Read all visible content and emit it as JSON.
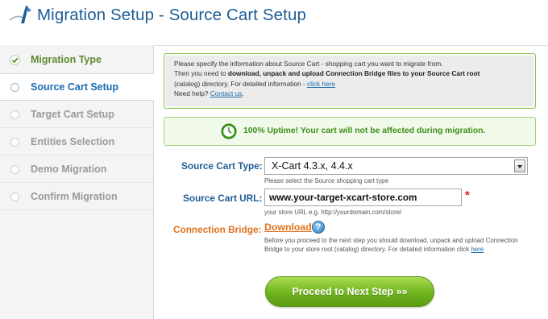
{
  "header": {
    "title": "Migration Setup - Source Cart Setup"
  },
  "sidebar": {
    "items": [
      {
        "label": "Migration Type",
        "state": "done"
      },
      {
        "label": "Source Cart Setup",
        "state": "active"
      },
      {
        "label": "Target Cart Setup",
        "state": "pending"
      },
      {
        "label": "Entities Selection",
        "state": "pending"
      },
      {
        "label": "Demo Migration",
        "state": "pending"
      },
      {
        "label": "Confirm Migration",
        "state": "pending"
      }
    ]
  },
  "info": {
    "line1": "Please specify the information about Source Cart - shopping cart you want to migrate from.",
    "line2_pre": "Then you need to ",
    "line2_bold": "download, unpack and upload Connection Bridge files to your Source Cart root",
    "line3_pre": "(catalog) directory. For detailed information - ",
    "line3_link": "click here",
    "line4_pre": "Need help? ",
    "line4_link": "Contact us",
    "line4_post": "."
  },
  "uptime": {
    "text": "100% Uptime! Your cart will not be affected during migration."
  },
  "form": {
    "source_type_label": "Source Cart Type:",
    "source_type_value": "X-Cart 4.3.x, 4.4.x",
    "source_type_hint": "Please select the Source shopping cart type",
    "url_label": "Source Cart URL:",
    "url_value": "www.your-target-xcart-store.com",
    "url_required": "*",
    "url_hint": "your store URL e.g. http://yourdomain.com/store/",
    "bridge_label": "Connection Bridge:",
    "bridge_link": "Download",
    "help_glyph": "?",
    "bridge_desc": "Before you proceed to the next step you should download, unpack and upload Connection Bridge to your store root (catalog) directory. For detailed information click ",
    "bridge_desc_link": "here"
  },
  "actions": {
    "proceed_label": "Proceed to Next Step »»"
  },
  "colors": {
    "accent_blue": "#1d5d96",
    "accent_green": "#6fb41e",
    "accent_orange": "#e0701c"
  }
}
